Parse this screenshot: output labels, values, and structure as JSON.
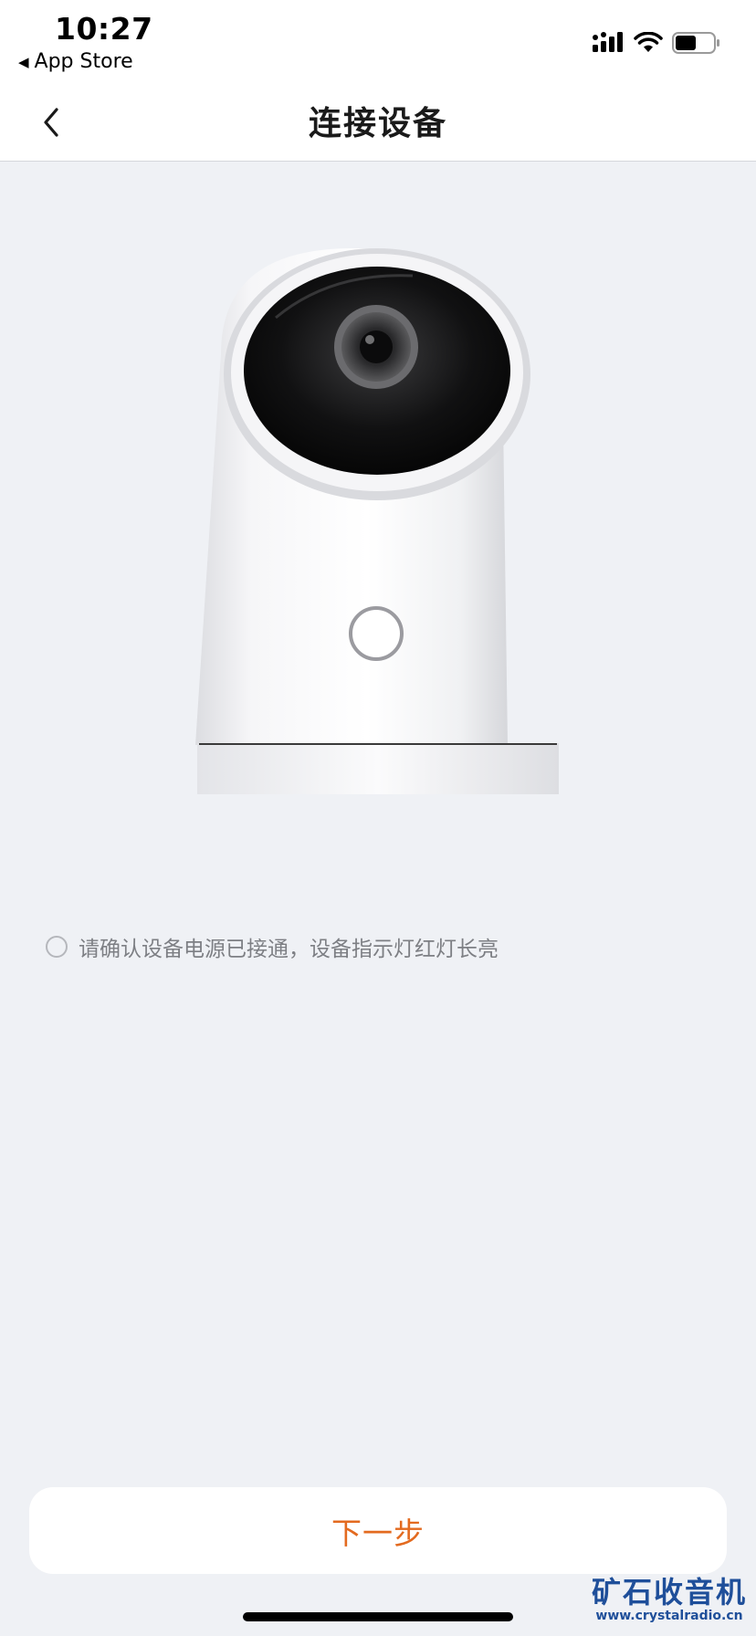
{
  "status_bar": {
    "time": "10:27",
    "back_app_label": "App Store",
    "back_arrow_icon": "triangle-left-icon",
    "signal_icon": "cellular-signal-icon",
    "wifi_icon": "wifi-icon",
    "battery_icon": "battery-icon",
    "battery_level": 0.55
  },
  "nav": {
    "title": "连接设备",
    "back_icon": "chevron-left-icon"
  },
  "device": {
    "image": "security-camera-illustration"
  },
  "confirm": {
    "text": "请确认设备电源已接通，设备指示灯红灯长亮",
    "checked": false
  },
  "footer": {
    "next_label": "下一步"
  },
  "watermark": {
    "title": "矿石收音机",
    "url": "www.crystalradio.cn"
  },
  "colors": {
    "background": "#eff1f5",
    "accent": "#e36a1f",
    "watermark": "#1f4f9a"
  }
}
